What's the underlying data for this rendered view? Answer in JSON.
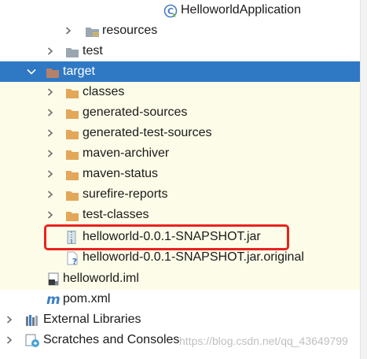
{
  "tree": {
    "rows": [
      {
        "label": "HelloworldApplication",
        "icon": "spring-class-icon"
      },
      {
        "label": "resources",
        "icon": "resources-folder-icon"
      },
      {
        "label": "test",
        "icon": "folder-icon"
      },
      {
        "label": "target",
        "icon": "folder-icon"
      },
      {
        "label": "classes",
        "icon": "folder-icon"
      },
      {
        "label": "generated-sources",
        "icon": "folder-icon"
      },
      {
        "label": "generated-test-sources",
        "icon": "folder-icon"
      },
      {
        "label": "maven-archiver",
        "icon": "folder-icon"
      },
      {
        "label": "maven-status",
        "icon": "folder-icon"
      },
      {
        "label": "surefire-reports",
        "icon": "folder-icon"
      },
      {
        "label": "test-classes",
        "icon": "folder-icon"
      },
      {
        "label": "helloworld-0.0.1-SNAPSHOT.jar",
        "icon": "jar-file-icon"
      },
      {
        "label": "helloworld-0.0.1-SNAPSHOT.jar.original",
        "icon": "unknown-file-icon"
      },
      {
        "label": "helloworld.iml",
        "icon": "iml-file-icon"
      },
      {
        "label": "pom.xml",
        "icon": "maven-icon"
      },
      {
        "label": "External Libraries",
        "icon": "libraries-icon"
      },
      {
        "label": "Scratches and Consoles",
        "icon": "scratches-icon"
      }
    ]
  },
  "colors": {
    "selection": "#2f78c4",
    "folder": "#e3a75a",
    "folder_gray": "#9aa7b0",
    "highlight_border": "#e8231f",
    "excluded_background": "#fdfce8"
  },
  "watermark": "https://blog.csdn.net/qq_43649799"
}
